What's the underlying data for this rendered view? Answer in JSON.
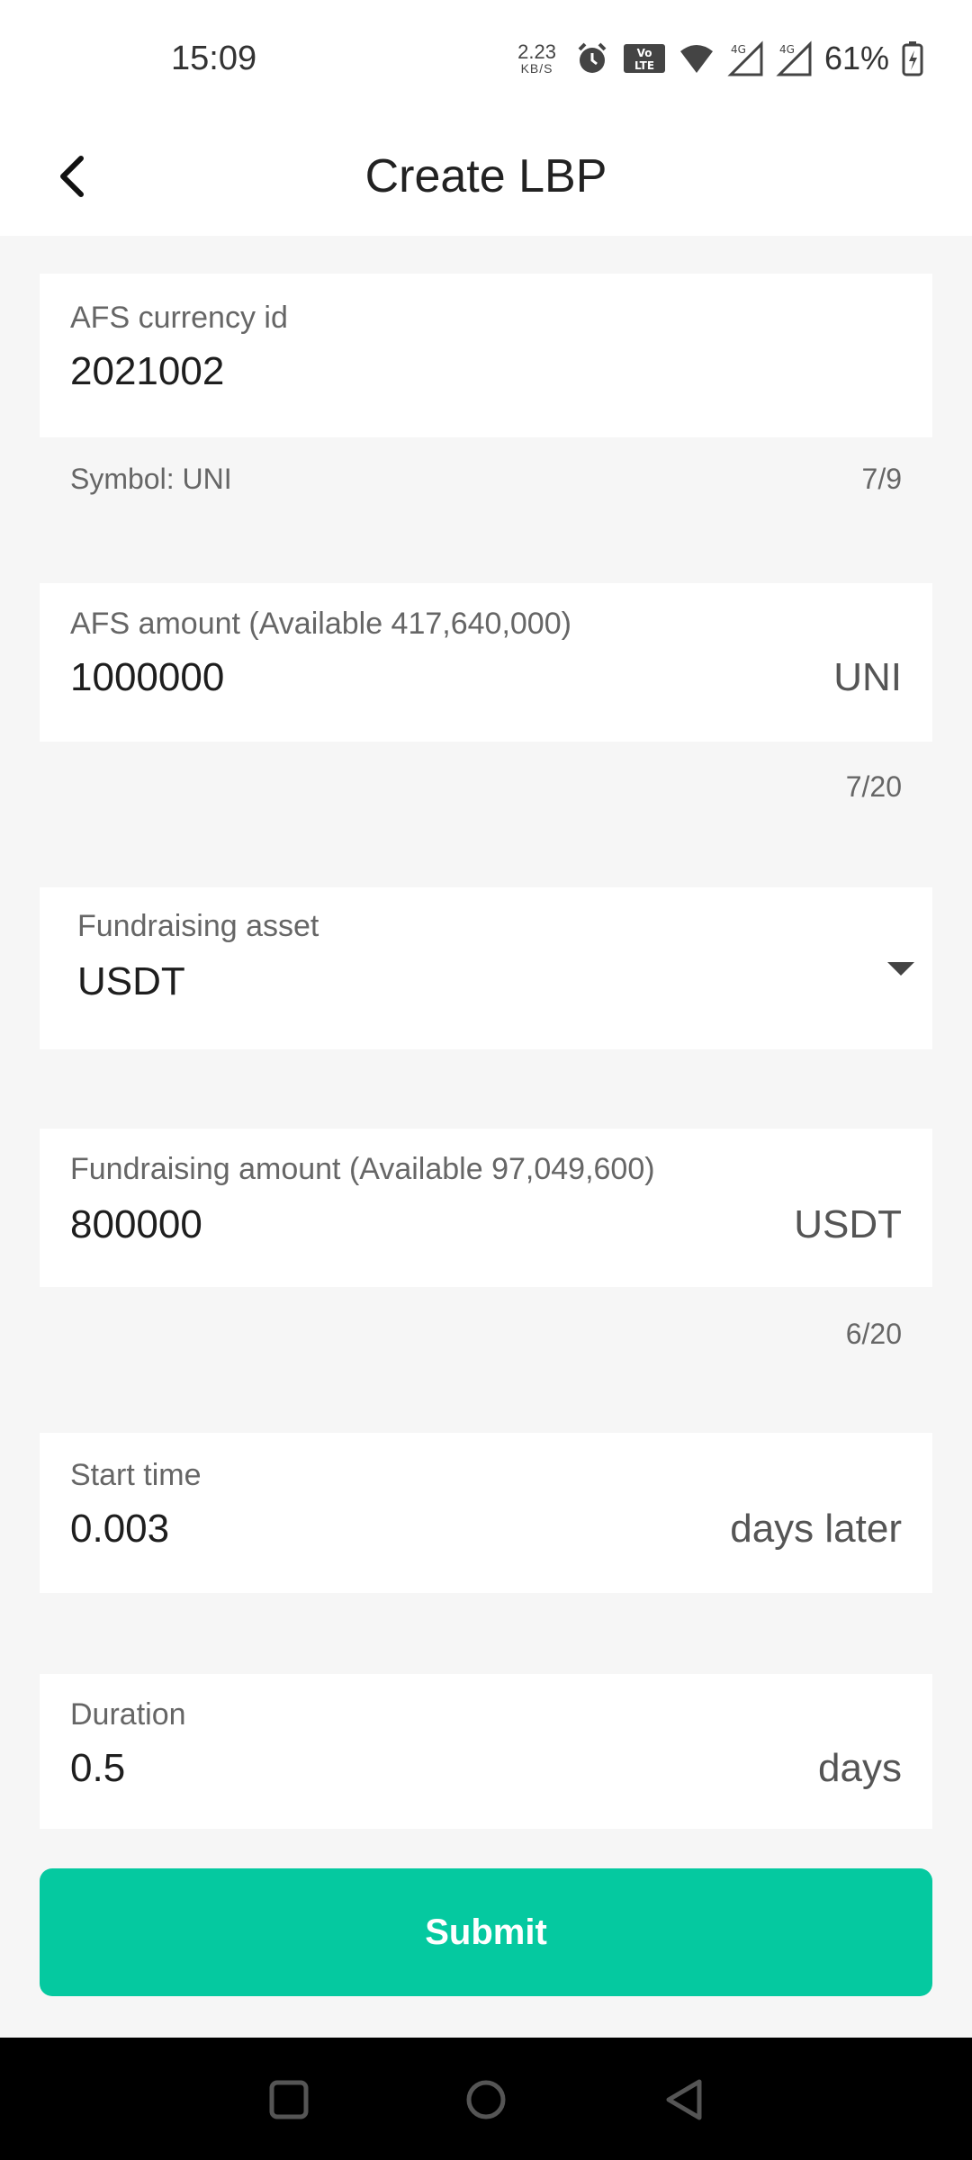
{
  "status_bar": {
    "time": "15:09",
    "net_speed_value": "2.23",
    "net_speed_unit": "KB/S",
    "battery": "61%"
  },
  "header": {
    "title": "Create LBP"
  },
  "form": {
    "currency_id": {
      "label": "AFS currency id",
      "value": "2021002",
      "symbol": "Symbol: UNI",
      "counter": "7/9"
    },
    "afs_amount": {
      "label": "AFS amount (Available 417,640,000)",
      "value": "1000000",
      "unit": "UNI",
      "counter": "7/20"
    },
    "fund_asset": {
      "label": "Fundraising asset",
      "value": "USDT"
    },
    "fund_amount": {
      "label": "Fundraising amount (Available 97,049,600)",
      "value": "800000",
      "unit": "USDT",
      "counter": "6/20"
    },
    "start_time": {
      "label": "Start time",
      "value": "0.003",
      "unit": "days later"
    },
    "duration": {
      "label": "Duration",
      "value": "0.5",
      "unit": "days"
    }
  },
  "submit_label": "Submit",
  "colors": {
    "accent": "#05c9a0",
    "background": "#f6f6f6",
    "card": "#ffffff"
  }
}
